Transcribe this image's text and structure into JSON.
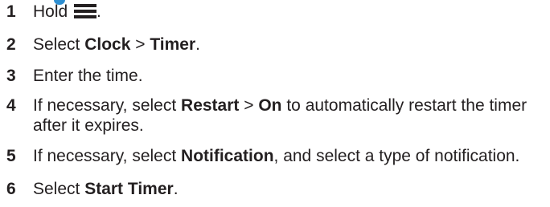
{
  "steps": [
    {
      "number": "1",
      "parts": [
        {
          "text": "Hold ",
          "bold": false
        }
      ],
      "icon": "menu-icon",
      "after_icon": "."
    },
    {
      "number": "2",
      "parts": [
        {
          "text": "Select ",
          "bold": false
        },
        {
          "text": "Clock",
          "bold": true
        },
        {
          "text": " > ",
          "bold": false
        },
        {
          "text": "Timer",
          "bold": true
        },
        {
          "text": ".",
          "bold": false
        }
      ]
    },
    {
      "number": "3",
      "parts": [
        {
          "text": "Enter the time.",
          "bold": false
        }
      ]
    },
    {
      "number": "4",
      "parts": [
        {
          "text": "If necessary, select ",
          "bold": false
        },
        {
          "text": "Restart",
          "bold": true
        },
        {
          "text": " > ",
          "bold": false
        },
        {
          "text": "On",
          "bold": true
        },
        {
          "text": " to automatically restart the timer after it expires.",
          "bold": false
        }
      ]
    },
    {
      "number": "5",
      "parts": [
        {
          "text": "If necessary, select ",
          "bold": false
        },
        {
          "text": "Notification",
          "bold": true
        },
        {
          "text": ", and select a type of notification.",
          "bold": false
        }
      ]
    },
    {
      "number": "6",
      "parts": [
        {
          "text": "Select ",
          "bold": false
        },
        {
          "text": "Start Timer",
          "bold": true
        },
        {
          "text": ".",
          "bold": false
        }
      ]
    }
  ],
  "colors": {
    "text": "#231f20",
    "accent": "#2f8fd1"
  }
}
